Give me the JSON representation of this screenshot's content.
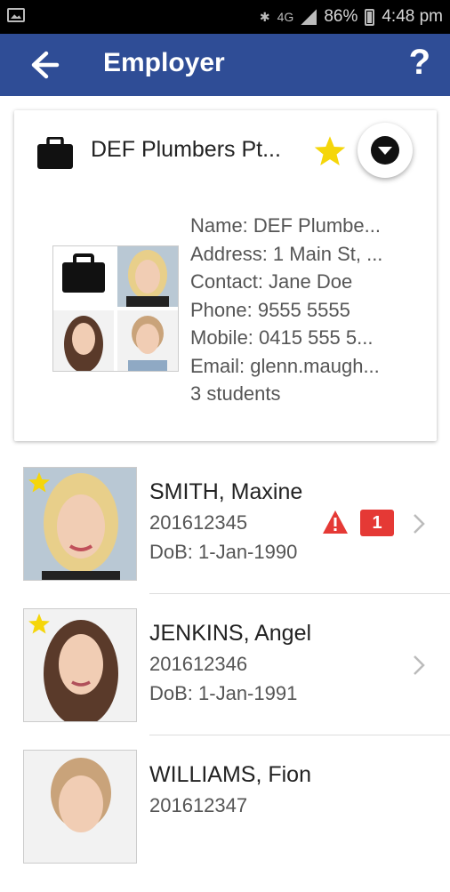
{
  "status_bar": {
    "network": "4G",
    "battery": "86%",
    "time": "4:48 pm"
  },
  "app_bar": {
    "title": "Employer",
    "help_label": "?"
  },
  "employer": {
    "name": "DEF Plumbers Pt...",
    "favorite": true,
    "details": {
      "name": "Name: DEF Plumbe...",
      "address": "Address: 1 Main St, ...",
      "contact": "Contact: Jane Doe",
      "phone": "Phone: 9555 5555",
      "mobile": "Mobile: 0415 555 5...",
      "email": "Email: glenn.maugh...",
      "students": "3 students"
    }
  },
  "students": [
    {
      "name": "SMITH, Maxine",
      "id": "201612345",
      "dob": "DoB: 1-Jan-1990",
      "favorite": true,
      "alert_count": "1",
      "hair": "#e8cf8a",
      "bg": "#b9c8d4"
    },
    {
      "name": "JENKINS, Angela",
      "id": "201612346",
      "dob": "DoB: 1-Jan-1991",
      "favorite": true,
      "alert_count": "",
      "hair": "#5a3a2a",
      "bg": "#f2f2f2"
    },
    {
      "name": "WILLIAMS, Fiona",
      "id": "201612347",
      "dob": "",
      "favorite": false,
      "alert_count": "",
      "hair": "#c9a37a",
      "bg": "#f2f2f2"
    }
  ],
  "colors": {
    "app_bar": "#2f4d96",
    "star": "#f5d60a",
    "alert": "#e53935"
  }
}
